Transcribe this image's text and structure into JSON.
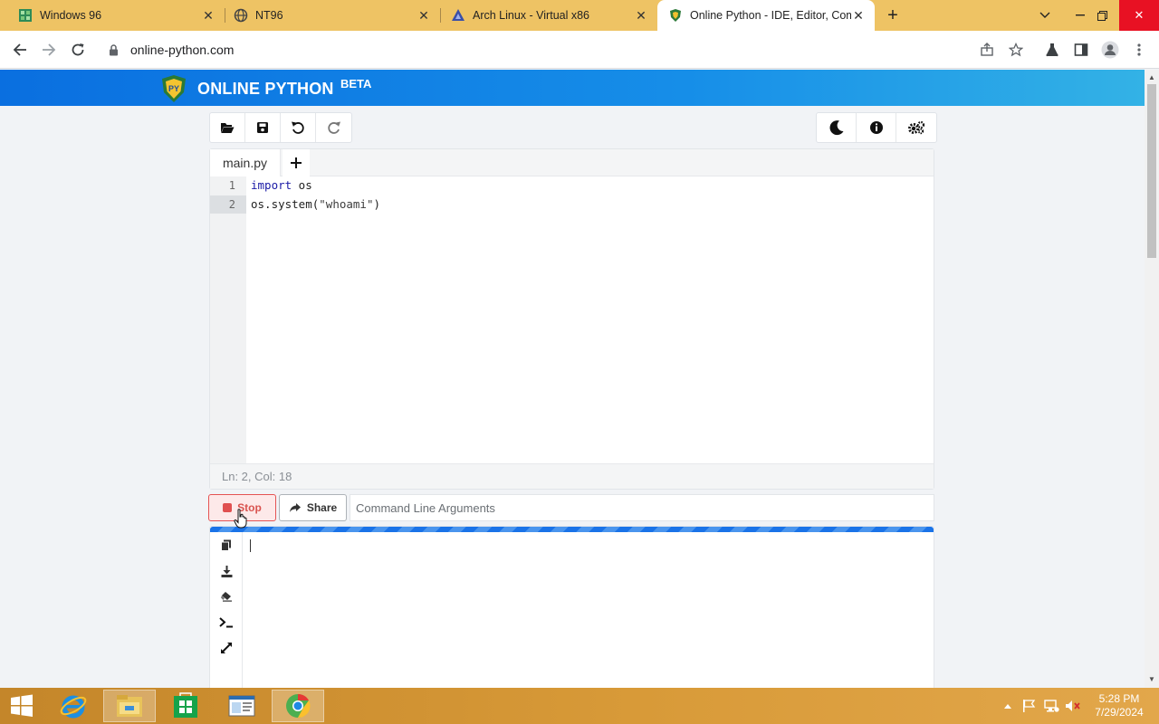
{
  "browser": {
    "tabs": [
      {
        "title": "Windows 96",
        "icon": "windows96-icon",
        "active": false
      },
      {
        "title": "NT96",
        "icon": "globe-icon",
        "active": false
      },
      {
        "title": "Arch Linux - Virtual x86",
        "icon": "virtual-x86-icon",
        "active": false
      },
      {
        "title": "Online Python - IDE, Editor, Com",
        "icon": "online-python-shield-icon",
        "active": true
      }
    ],
    "url": "online-python.com"
  },
  "site": {
    "brand": "ONLINE PYTHON",
    "badge": "BETA",
    "logo_text": "PY"
  },
  "editor": {
    "file_tab": "main.py",
    "lines": [
      {
        "no": "1",
        "keyword": "import",
        "rest": " os"
      },
      {
        "no": "2",
        "prefix": "os.system(",
        "string": "\"whoami\"",
        "suffix": ")"
      }
    ],
    "status": "Ln: 2,  Col: 18"
  },
  "run": {
    "stop_label": "Stop",
    "share_label": "Share",
    "args_placeholder": "Command Line Arguments"
  },
  "taskbar": {
    "time": "5:28 PM",
    "date": "7/29/2024"
  },
  "colors": {
    "header_blue": "#0a6fe0",
    "stop_red": "#e05050",
    "taskbar": "#d89a38"
  }
}
